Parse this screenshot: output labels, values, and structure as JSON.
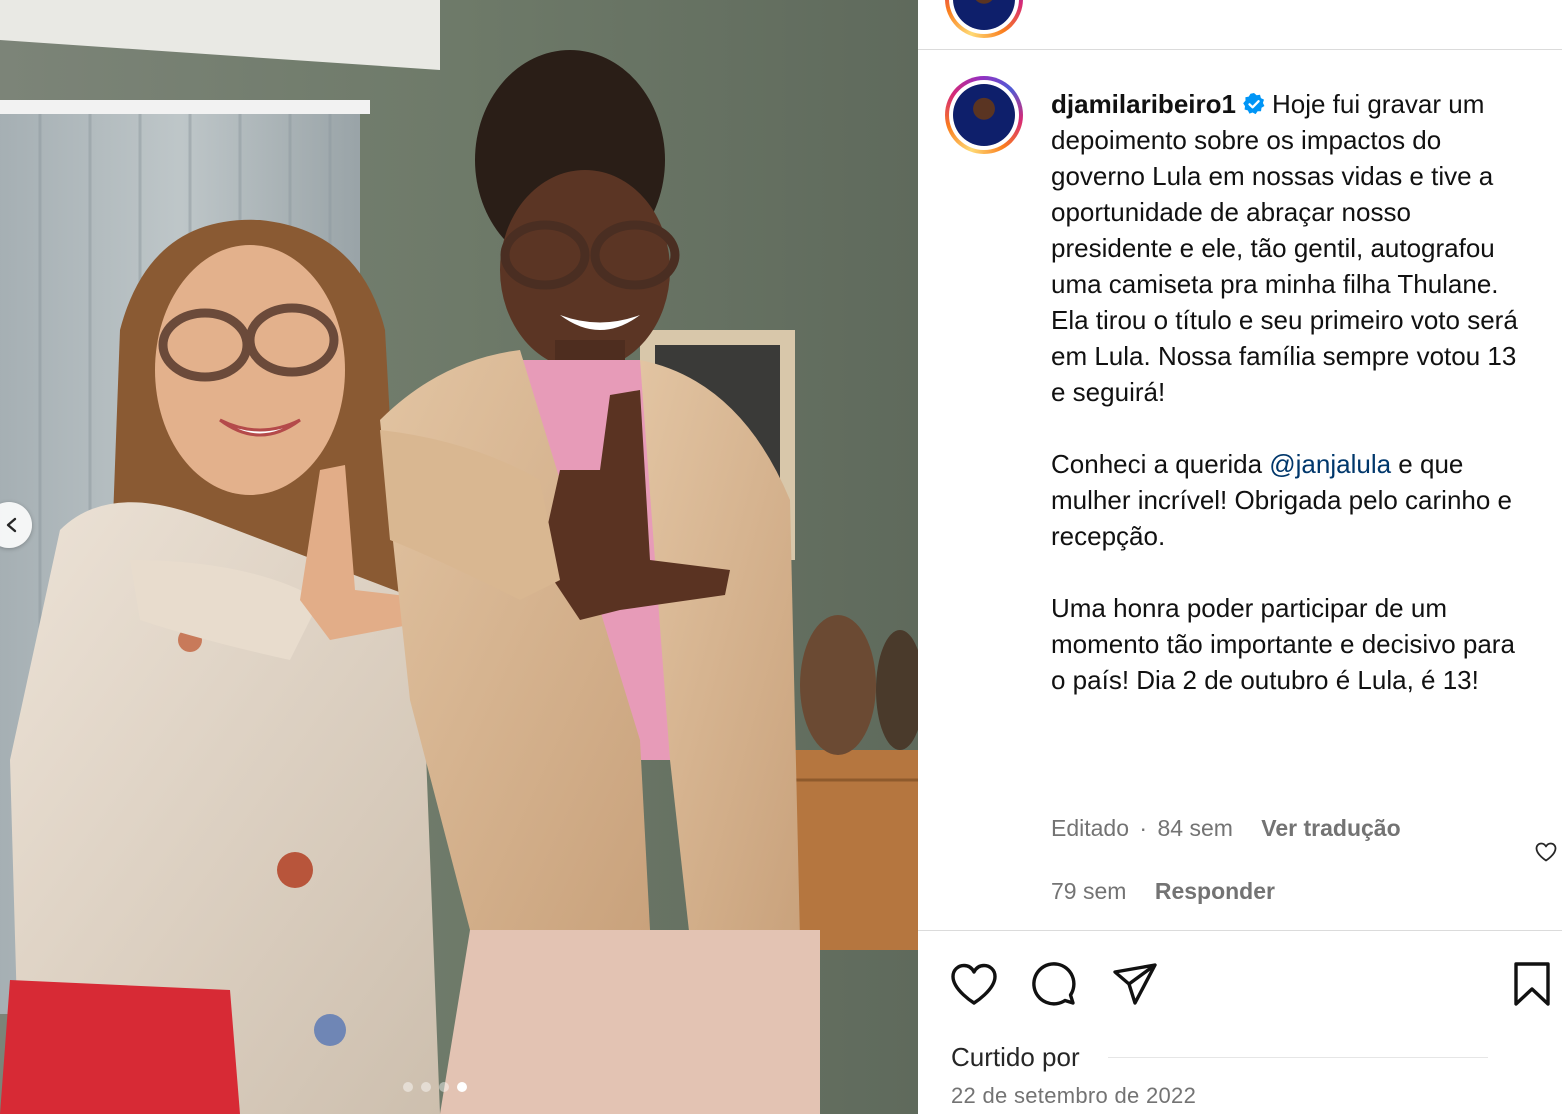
{
  "post": {
    "username": "djamilaribeiro1",
    "verified": true,
    "caption_part1": "Hoje fui gravar um depoimento sobre os impactos do governo Lula em nossas vidas e tive a oportunidade de abraçar nosso presidente e ele, tão gentil, autografou uma camiseta pra minha filha Thulane. Ela tirou o título e seu primeiro voto será em Lula. Nossa família sempre votou 13 e seguirá!\n\nConheci a querida ",
    "mention": "@janjalula",
    "caption_part2": " e que mulher incrível! Obrigada pelo carinho e recepção.\n\nUma honra poder participar de um momento tão importante e decisivo para o país! Dia 2 de outubro é Lula, é 13!",
    "meta_edited": "Editado",
    "meta_separator": "·",
    "meta_age": "84 sem",
    "translate_label": "Ver tradução"
  },
  "comment": {
    "age": "79 sem",
    "reply_label": "Responder",
    "like_icon": "heart-outline-icon"
  },
  "actions": {
    "icons": [
      "heart-icon",
      "comment-icon",
      "share-icon",
      "bookmark-icon"
    ]
  },
  "likes": {
    "label": "Curtido por"
  },
  "date": "22 de setembro de 2022",
  "carousel": {
    "total": 4,
    "active": 4
  },
  "colors": {
    "link": "#00376b",
    "muted": "#737373",
    "verified": "#0095f6",
    "divider": "#dbdbdb"
  }
}
